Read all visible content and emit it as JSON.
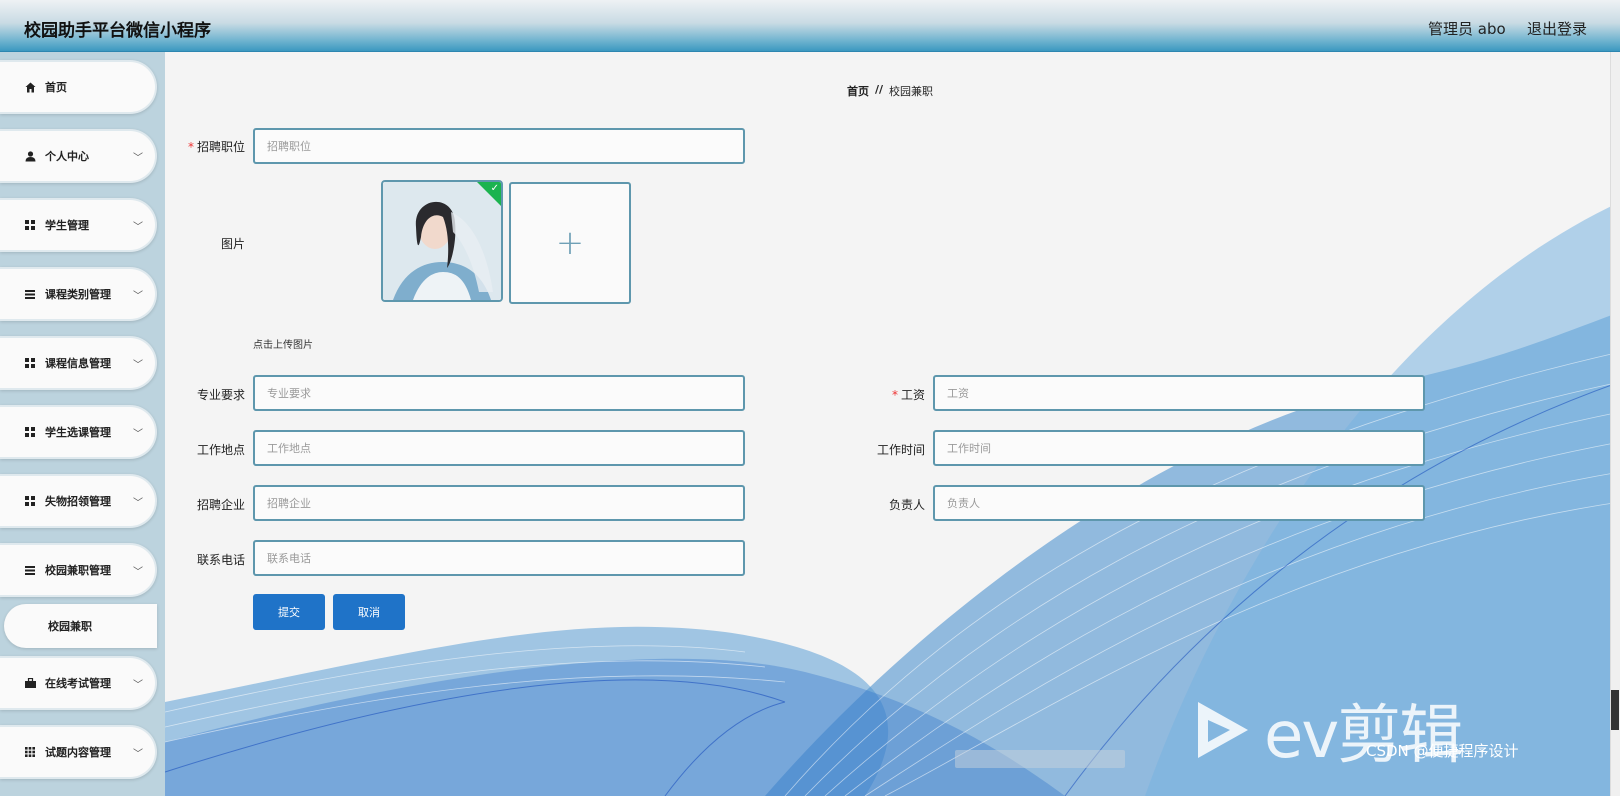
{
  "header": {
    "title": "校园助手平台微信小程序",
    "admin_label": "管理员 abo",
    "logout": "退出登录"
  },
  "sidebar": {
    "items": [
      {
        "label": "首页",
        "icon": "home-icon",
        "expandable": false
      },
      {
        "label": "个人中心",
        "icon": "user-icon",
        "expandable": true
      },
      {
        "label": "学生管理",
        "icon": "grid-icon",
        "expandable": true
      },
      {
        "label": "课程类别管理",
        "icon": "list-icon",
        "expandable": true
      },
      {
        "label": "课程信息管理",
        "icon": "grid-icon",
        "expandable": true
      },
      {
        "label": "学生选课管理",
        "icon": "grid-icon",
        "expandable": true
      },
      {
        "label": "失物招领管理",
        "icon": "grid-icon",
        "expandable": true
      },
      {
        "label": "校园兼职管理",
        "icon": "list-icon",
        "expandable": true
      },
      {
        "label": "在线考试管理",
        "icon": "briefcase-icon",
        "expandable": true
      },
      {
        "label": "试题内容管理",
        "icon": "table-icon",
        "expandable": true
      }
    ],
    "submenu": {
      "label": "校园兼职"
    }
  },
  "breadcrumb": {
    "home": "首页",
    "separator": "//",
    "current": "校园兼职"
  },
  "form": {
    "job_title": {
      "label": "招聘职位",
      "required": true,
      "placeholder": "招聘职位",
      "value": ""
    },
    "image": {
      "label": "图片",
      "hint": "点击上传图片"
    },
    "major": {
      "label": "专业要求",
      "required": false,
      "placeholder": "专业要求"
    },
    "salary": {
      "label": "工资",
      "required": true,
      "placeholder": "工资"
    },
    "location": {
      "label": "工作地点",
      "required": false,
      "placeholder": "工作地点"
    },
    "work_time": {
      "label": "工作时间",
      "required": false,
      "placeholder": "工作时间"
    },
    "company": {
      "label": "招聘企业",
      "required": false,
      "placeholder": "招聘企业"
    },
    "owner": {
      "label": "负责人",
      "required": false,
      "placeholder": "负责人"
    },
    "phone": {
      "label": "联系电话",
      "required": false,
      "placeholder": "联系电话"
    },
    "submit": "提交",
    "cancel": "取消"
  },
  "overlay": {
    "watermark": "ev剪辑",
    "credit": "CSDN @便捷程序设计"
  },
  "colors": {
    "accent": "#1f73c8",
    "field_border": "#5e97ad",
    "required": "#e33333",
    "sidebar_bg": "#bcd3de",
    "wave": "#1a66c4"
  }
}
